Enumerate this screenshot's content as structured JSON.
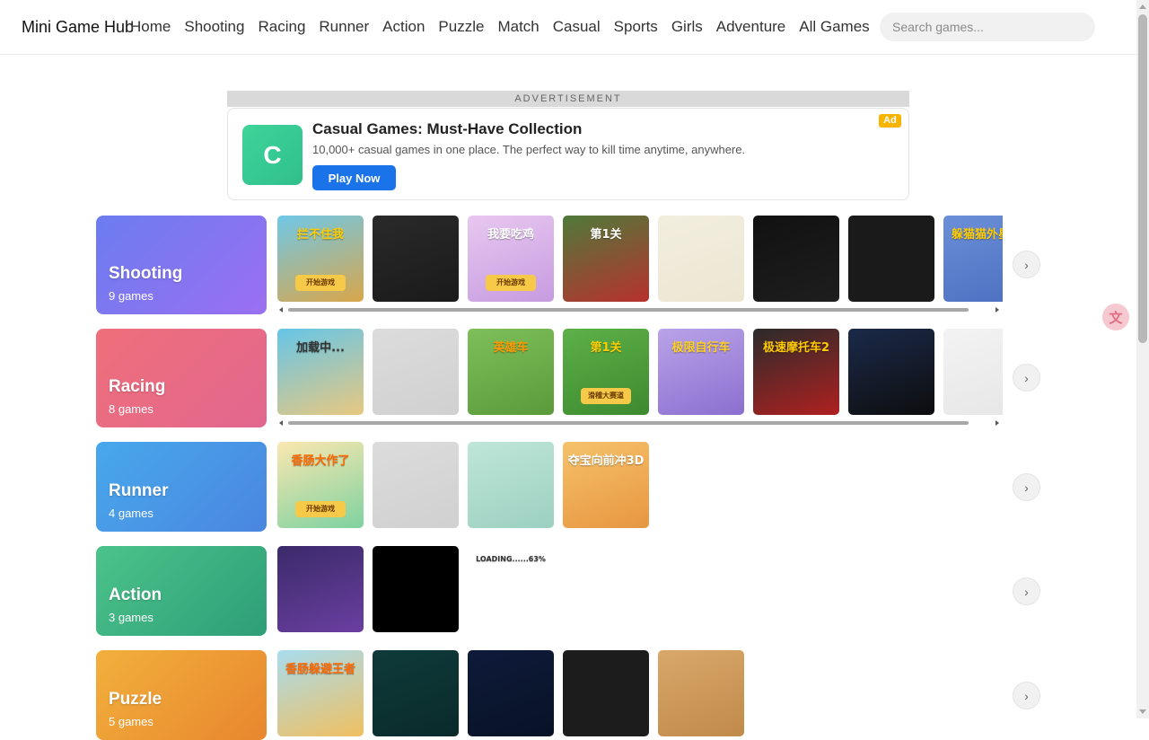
{
  "header": {
    "brand": "Mini Game Hub",
    "nav": [
      "Home",
      "Shooting",
      "Racing",
      "Runner",
      "Action",
      "Puzzle",
      "Match",
      "Casual",
      "Sports",
      "Girls",
      "Adventure",
      "All Games"
    ],
    "search_placeholder": "Search games..."
  },
  "ad": {
    "label": "ADVERTISEMENT",
    "logo_letter": "C",
    "title": "Casual Games: Must-Have Collection",
    "text": "10,000+ casual games in one place. The perfect way to kill time anytime, anywhere.",
    "button": "Play Now",
    "badge": "Ad",
    "logo_color": "#35c892",
    "button_color": "#1a73e8",
    "badge_color": "#f6b400"
  },
  "categories": [
    {
      "name": "Shooting",
      "count": "9 games",
      "gradient": [
        "#6b7cf0",
        "#9b6ff0"
      ],
      "thumbs": [
        {
          "label": "拦不住我",
          "sub": "开始游戏",
          "colors": [
            "#6fc8e8",
            "#d9a64a"
          ],
          "text_color": "#ffcc00"
        },
        {
          "label": "",
          "sub": "",
          "colors": [
            "#2a2a2a",
            "#1a1a1a"
          ],
          "text_color": "#fff"
        },
        {
          "label": "我要吃鸡",
          "sub": "开始游戏",
          "colors": [
            "#e7c8f0",
            "#c79be0"
          ],
          "text_color": "#fff"
        },
        {
          "label": "第1关",
          "sub": "",
          "colors": [
            "#4f7a3a",
            "#b8312f"
          ],
          "text_color": "#fff"
        },
        {
          "label": "",
          "sub": "",
          "colors": [
            "#f2eedf",
            "#ece6d2"
          ],
          "text_color": "#333"
        },
        {
          "label": "",
          "sub": "",
          "colors": [
            "#111111",
            "#1e1e1e"
          ],
          "text_color": "#fff"
        },
        {
          "label": "",
          "sub": "",
          "colors": [
            "#1a1a1a",
            "#1a1a1a"
          ],
          "text_color": "#fff"
        },
        {
          "label": "躲猫猫外星人",
          "sub": "",
          "colors": [
            "#6b8fd8",
            "#4c6fc0"
          ],
          "text_color": "#ffcc00"
        }
      ]
    },
    {
      "name": "Racing",
      "count": "8 games",
      "gradient": [
        "#ef6f7a",
        "#e2678f"
      ],
      "thumbs": [
        {
          "label": "加载中...",
          "sub": "",
          "colors": [
            "#65c5e8",
            "#e8c880"
          ],
          "text_color": "#333"
        },
        {
          "label": "",
          "sub": "",
          "colors": [
            "#dcdcdc",
            "#d0d0d0"
          ],
          "text_color": "#888"
        },
        {
          "label": "英雄车",
          "sub": "",
          "colors": [
            "#7fbf5a",
            "#5a9a3a"
          ],
          "text_color": "#ff9900"
        },
        {
          "label": "第1关",
          "sub": "滑稽大赛道",
          "colors": [
            "#5db049",
            "#3d8a2f"
          ],
          "text_color": "#ffcc00"
        },
        {
          "label": "极限自行车",
          "sub": "",
          "colors": [
            "#b9a3e8",
            "#8b6fd0"
          ],
          "text_color": "#ffd21f"
        },
        {
          "label": "极速摩托车2",
          "sub": "",
          "colors": [
            "#2b2b2b",
            "#b02020"
          ],
          "text_color": "#ffcc00"
        },
        {
          "label": "",
          "sub": "",
          "colors": [
            "#1b2a4a",
            "#0d0d0d"
          ],
          "text_color": "#fff"
        },
        {
          "label": "",
          "sub": "",
          "colors": [
            "#f3f3f3",
            "#e6e6e6"
          ],
          "text_color": "#c62828"
        }
      ]
    },
    {
      "name": "Runner",
      "count": "4 games",
      "gradient": [
        "#48a8ec",
        "#4a86e0"
      ],
      "thumbs": [
        {
          "label": "香肠大作了",
          "sub": "开始游戏",
          "colors": [
            "#fbe7b0",
            "#7ed2a0"
          ],
          "text_color": "#ff6a00"
        },
        {
          "label": "",
          "sub": "",
          "colors": [
            "#dcdcdc",
            "#d0d0d0"
          ],
          "text_color": "#888"
        },
        {
          "label": "",
          "sub": "",
          "colors": [
            "#bfe6d8",
            "#9cd0c0"
          ],
          "text_color": "#333"
        },
        {
          "label": "夺宝向前冲3D",
          "sub": "",
          "colors": [
            "#f5c26b",
            "#e89640"
          ],
          "text_color": "#fff"
        }
      ]
    },
    {
      "name": "Action",
      "count": "3 games",
      "gradient": [
        "#4bc38a",
        "#2e9e78"
      ],
      "thumbs": [
        {
          "label": "",
          "sub": "",
          "colors": [
            "#3b2a6a",
            "#6a3fa0"
          ],
          "text_color": "#fff"
        },
        {
          "label": "",
          "sub": "",
          "colors": [
            "#000000",
            "#000000"
          ],
          "text_color": "#fff"
        },
        {
          "label": "LOADING......63%",
          "sub": "",
          "colors": [
            "#ffffff",
            "#ffffff"
          ],
          "text_color": "#333"
        }
      ]
    },
    {
      "name": "Puzzle",
      "count": "5 games",
      "gradient": [
        "#f2b03c",
        "#e8862e"
      ],
      "thumbs": [
        {
          "label": "香肠躲避王者",
          "sub": "",
          "colors": [
            "#a8dcef",
            "#f0c060"
          ],
          "text_color": "#ff6a00"
        },
        {
          "label": "",
          "sub": "",
          "colors": [
            "#0f3a3a",
            "#0a2a2a"
          ],
          "text_color": "#fff"
        },
        {
          "label": "",
          "sub": "",
          "colors": [
            "#0e1a3a",
            "#081226"
          ],
          "text_color": "#fff"
        },
        {
          "label": "",
          "sub": "",
          "colors": [
            "#1c1c1c",
            "#1c1c1c"
          ],
          "text_color": "#fff"
        },
        {
          "label": "",
          "sub": "",
          "colors": [
            "#d8a86a",
            "#c08a4a"
          ],
          "text_color": "#fff"
        }
      ]
    }
  ],
  "next_arrow": "›"
}
